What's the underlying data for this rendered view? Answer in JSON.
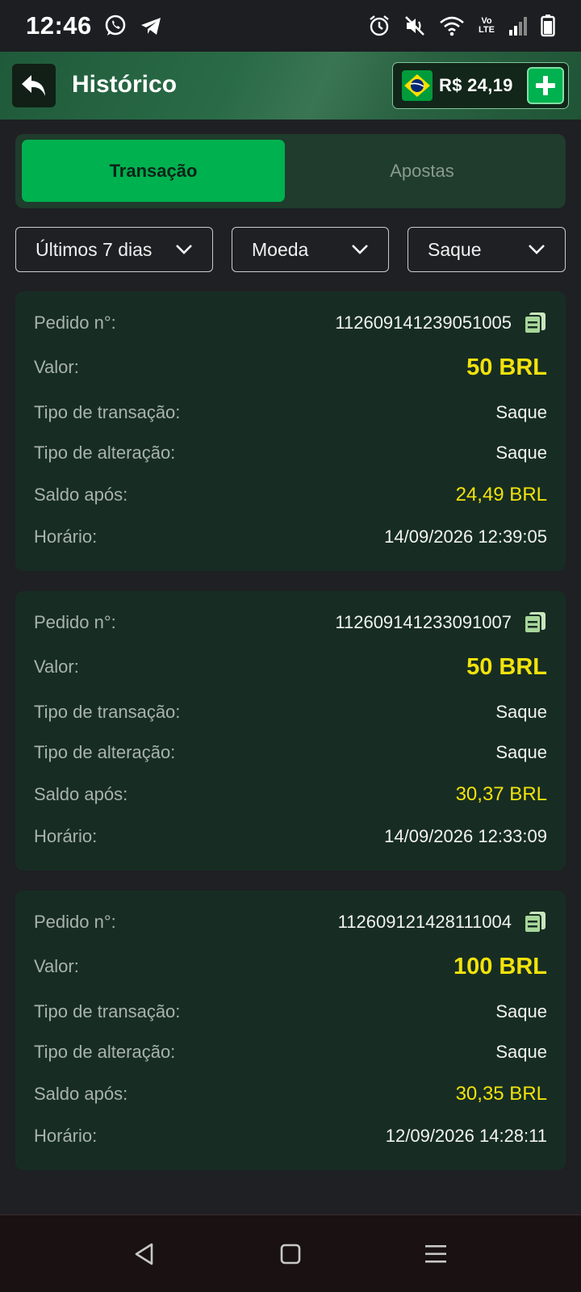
{
  "status_bar": {
    "time": "12:46",
    "left_icons": [
      "whatsapp-icon",
      "telegram-icon"
    ],
    "right_icons": [
      "alarm-icon",
      "mute-icon",
      "wifi-icon",
      "volte-icon",
      "signal-icon",
      "battery-icon"
    ],
    "volte_text": "Vo LTE"
  },
  "header": {
    "title": "Histórico",
    "balance": "R$ 24,19"
  },
  "tabs": [
    {
      "label": "Transação",
      "active": true
    },
    {
      "label": "Apostas",
      "active": false
    }
  ],
  "filters": {
    "period": "Últimos 7 dias",
    "currency": "Moeda",
    "type": "Saque"
  },
  "labels": {
    "order": "Pedido n°:",
    "amount": "Valor:",
    "transaction_type": "Tipo de transação:",
    "change_type": "Tipo de alteração:",
    "balance_after": "Saldo após:",
    "time": "Horário:"
  },
  "transactions": [
    {
      "order": "112609141239051005",
      "amount": "50 BRL",
      "transaction_type": "Saque",
      "change_type": "Saque",
      "balance_after": "24,49 BRL",
      "time": "14/09/2026 12:39:05"
    },
    {
      "order": "112609141233091007",
      "amount": "50 BRL",
      "transaction_type": "Saque",
      "change_type": "Saque",
      "balance_after": "30,37 BRL",
      "time": "14/09/2026 12:33:09"
    },
    {
      "order": "112609121428111004",
      "amount": "100 BRL",
      "transaction_type": "Saque",
      "change_type": "Saque",
      "balance_after": "30,35 BRL",
      "time": "12/09/2026 14:28:11"
    }
  ],
  "colors": {
    "accent_green": "#00b14f",
    "value_yellow": "#f2e20c",
    "card_bg": "#172d23"
  }
}
